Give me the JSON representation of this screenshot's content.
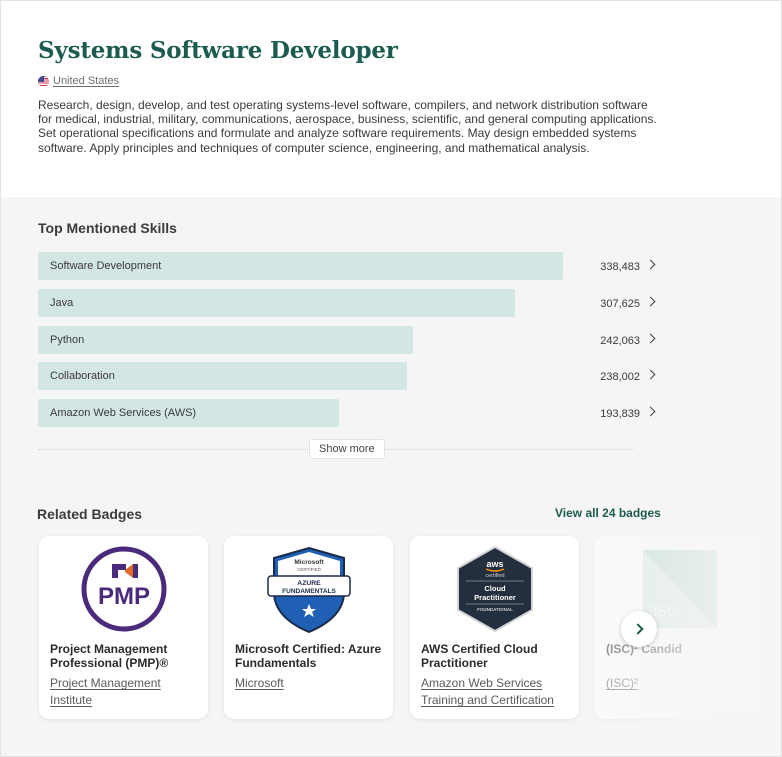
{
  "header": {
    "title": "Systems Software Developer",
    "location": "United States",
    "description": "Research, design, develop, and test operating systems-level software, compilers, and network distribution software for medical, industrial, military, communications, aerospace, business, scientific, and general computing applications. Set operational specifications and formulate and analyze software requirements. May design embedded systems software. Apply principles and techniques of computer science, engineering, and mathematical analysis."
  },
  "skills": {
    "title": "Top Mentioned Skills",
    "items": [
      {
        "name": "Software Development",
        "count": "338,483",
        "value": 338483
      },
      {
        "name": "Java",
        "count": "307,625",
        "value": 307625
      },
      {
        "name": "Python",
        "count": "242,063",
        "value": 242063
      },
      {
        "name": "Collaboration",
        "count": "238,002",
        "value": 238002
      },
      {
        "name": "Amazon Web Services (AWS)",
        "count": "193,839",
        "value": 193839
      }
    ],
    "show_more": "Show more"
  },
  "badges": {
    "title": "Related Badges",
    "view_all": "View all 24 badges",
    "items": [
      {
        "name": "Project Management Professional (PMP)®",
        "issuer": "Project Management Institute",
        "logo": "pmp-logo",
        "logo_text": "PMP"
      },
      {
        "name": "Microsoft Certified: Azure Fundamentals",
        "issuer": "Microsoft",
        "logo": "azure-fundamentals-shield",
        "logo_top": "Microsoft",
        "logo_sub": "CERTIFIED",
        "logo_main": "AZURE FUNDAMENTALS"
      },
      {
        "name": "AWS Certified Cloud Practitioner",
        "issuer": "Amazon Web Services Training and Certification",
        "logo": "aws-hexagon",
        "logo_top": "aws",
        "logo_sub": "certified",
        "logo_main": "Cloud Practitioner",
        "logo_foot": "FOUNDATIONAL"
      },
      {
        "name": "(ISC)² Candid",
        "issuer": "(ISC)²",
        "logo": "isc2-badge",
        "logo_text": "(ISC"
      }
    ]
  },
  "colors": {
    "brand": "#1c5b4f",
    "skill_bar": "#d3e6e3",
    "pmp_purple": "#4a2a7a",
    "azure_blue": "#1f5fb4",
    "aws_dark": "#232f3e"
  }
}
